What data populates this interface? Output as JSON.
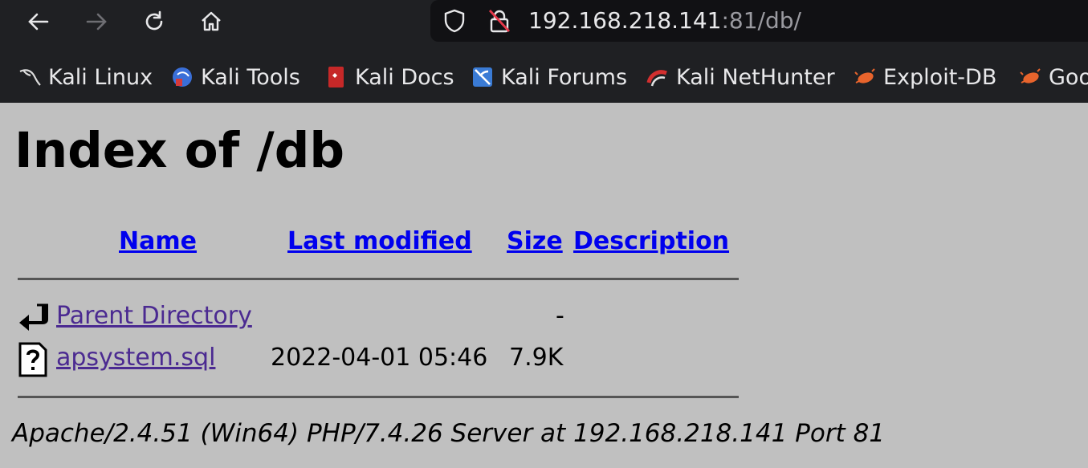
{
  "browser": {
    "url_host": "192.168.218.141",
    "url_rest": ":81/db/",
    "bookmarks": [
      {
        "label": "Kali Linux",
        "icon": "kali-dragon-icon"
      },
      {
        "label": "Kali Tools",
        "icon": "kali-tools-icon"
      },
      {
        "label": "Kali Docs",
        "icon": "kali-docs-icon"
      },
      {
        "label": "Kali Forums",
        "icon": "kali-forums-icon"
      },
      {
        "label": "Kali NetHunter",
        "icon": "kali-nethunter-icon"
      },
      {
        "label": "Exploit-DB",
        "icon": "exploit-db-icon"
      },
      {
        "label": "Goo",
        "icon": "google-hacking-db-icon"
      }
    ]
  },
  "page": {
    "title": "Index of /db",
    "columns": {
      "name": "Name",
      "last_modified": "Last modified",
      "size": "Size",
      "description": "Description"
    },
    "rows": [
      {
        "name": "Parent Directory",
        "last_modified": "",
        "size": "-",
        "icon": "back-arrow-icon"
      },
      {
        "name": "apsystem.sql",
        "last_modified": "2022-04-01 05:46",
        "size": "7.9K",
        "icon": "unknown-file-icon"
      }
    ],
    "footer": "Apache/2.4.51 (Win64) PHP/7.4.26 Server at 192.168.218.141 Port 81"
  }
}
